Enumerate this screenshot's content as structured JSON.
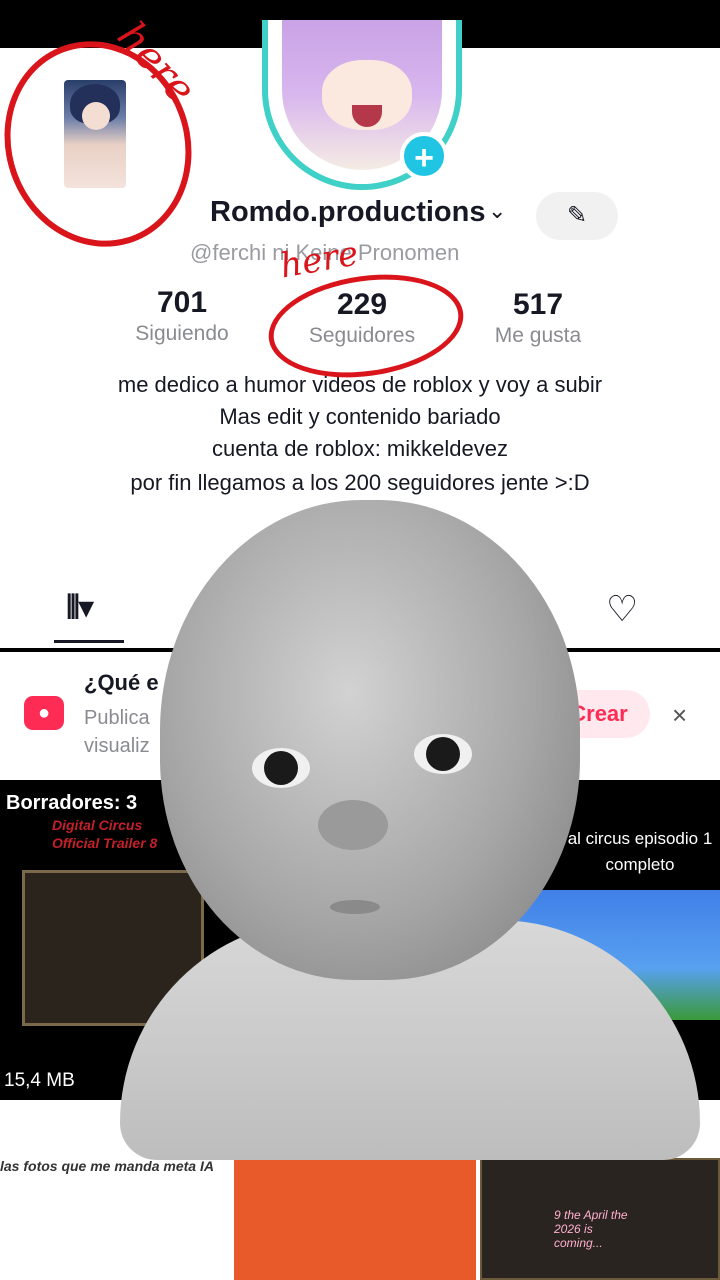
{
  "profile": {
    "username": "Romdo.productions",
    "handle": "@ferchi  ni    Keine Pronomen",
    "edit_icon": "pencil-icon",
    "chevron_icon": "chevron-down-icon"
  },
  "stats": [
    {
      "value": "701",
      "label": "Siguiendo"
    },
    {
      "value": "229",
      "label": "Seguidores"
    },
    {
      "value": "517",
      "label": "Me gusta"
    }
  ],
  "bio": [
    "me dedico a humor videos de roblox y voy a subir",
    "Mas edit y contenido bariado",
    "cuenta de roblox: mikkeldevez",
    "por fin llegamos a los 200 seguidores jente >:D"
  ],
  "tabs": {
    "grid_icon": "grid-icon",
    "liked_icon": "heart-icon"
  },
  "banner": {
    "title": "¿Qué e",
    "subtitle": "Publica visualiz",
    "cta": "Crear",
    "close": "×"
  },
  "grid": {
    "drafts_label": "Borradores: 3",
    "draft_title": "Digital Circus Official Trailer 8",
    "draft_size": "15,4 MB",
    "video2_title": "al circus episodio 1 completo",
    "row2_text1": "las fotos que me manda meta IA",
    "row2_text3": "9 the April the 2026 is coming..."
  },
  "annotations": [
    "here",
    "here"
  ],
  "colors": {
    "accent": "#fe2c55",
    "ring": "#3fd0c8",
    "marker": "#d9141b"
  }
}
